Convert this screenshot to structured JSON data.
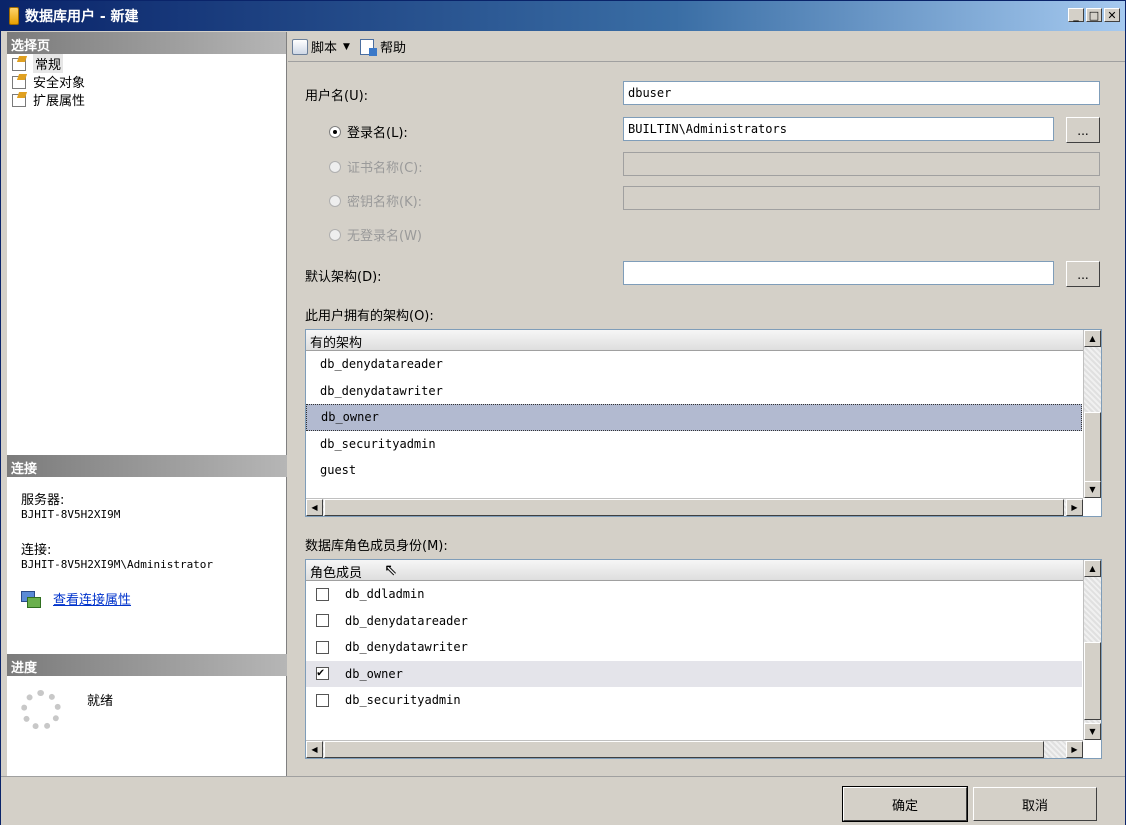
{
  "window": {
    "title": "数据库用户 - 新建",
    "min": "_",
    "max": "□",
    "close": "✕"
  },
  "left": {
    "select_page_header": "选择页",
    "pages": [
      {
        "label": "常规",
        "selected": true
      },
      {
        "label": "安全对象",
        "selected": false
      },
      {
        "label": "扩展属性",
        "selected": false
      }
    ],
    "connection_header": "连接",
    "server_label": "服务器:",
    "server_value": "BJHIT-8V5H2XI9M",
    "connection_label": "连接:",
    "connection_value": "BJHIT-8V5H2XI9M\\Administrator",
    "view_props_link": "查看连接属性",
    "progress_header": "进度",
    "progress_status": "就绪"
  },
  "toolbar": {
    "script_label": "脚本",
    "help_label": "帮助"
  },
  "form": {
    "username_label": "用户名(U):",
    "username_value": "dbuser",
    "login_label": "登录名(L):",
    "login_value": "BUILTIN\\Administrators",
    "cert_label": "证书名称(C):",
    "key_label": "密钥名称(K):",
    "nologin_label": "无登录名(W)",
    "schema_label": "默认架构(D):",
    "schema_value": "",
    "ellipsis": "...",
    "owned_schemas_label": "此用户拥有的架构(O):",
    "owned_schemas_header": "有的架构",
    "owned_schemas": [
      {
        "name": "db_denydatareader",
        "selected": false
      },
      {
        "name": "db_denydatawriter",
        "selected": false
      },
      {
        "name": "db_owner",
        "selected": true
      },
      {
        "name": "db_securityadmin",
        "selected": false
      },
      {
        "name": "guest",
        "selected": false
      }
    ],
    "roles_label": "数据库角色成员身份(M):",
    "roles_header": "角色成员",
    "roles": [
      {
        "name": "db_ddladmin",
        "checked": false
      },
      {
        "name": "db_denydatareader",
        "checked": false
      },
      {
        "name": "db_denydatawriter",
        "checked": false
      },
      {
        "name": "db_owner",
        "checked": true
      },
      {
        "name": "db_securityadmin",
        "checked": false
      }
    ]
  },
  "footer": {
    "ok_label": "确定",
    "cancel_label": "取消"
  }
}
